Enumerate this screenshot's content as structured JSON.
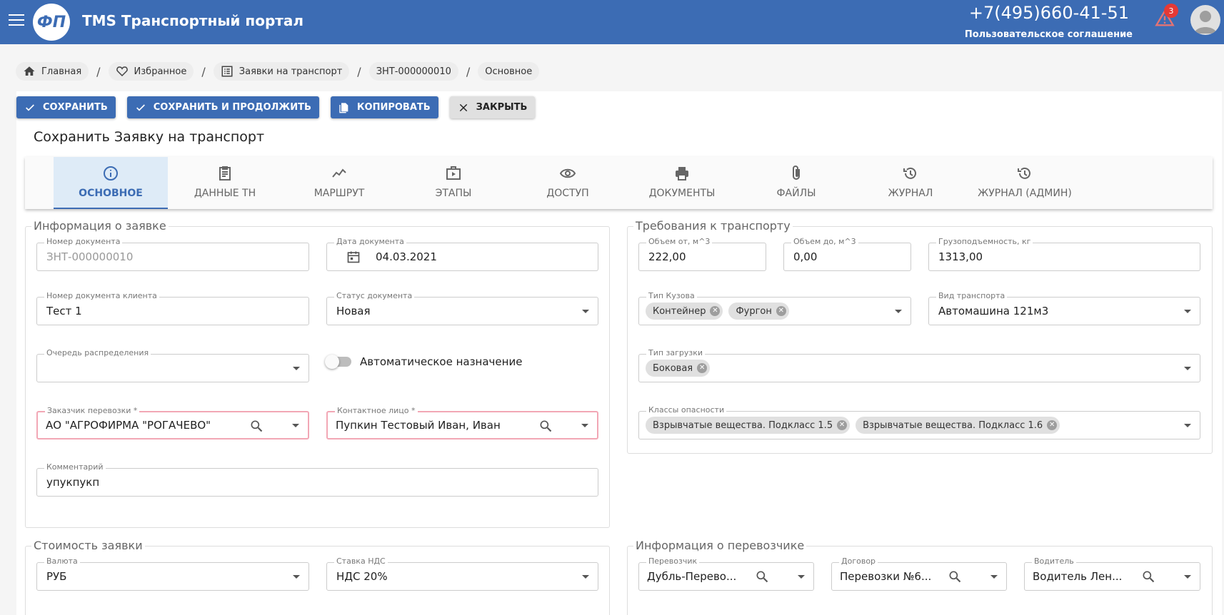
{
  "header": {
    "logo_text": "ФП",
    "app_title": "TMS Транспортный портал",
    "phone": "+7(495)660-41-51",
    "agreement": "Пользовательское соглашение",
    "notifications_count": "3"
  },
  "breadcrumbs": [
    "Главная",
    "Избранное",
    "Заявки на транспорт",
    "ЗНТ-000000010",
    "Основное"
  ],
  "toolbar": {
    "save": "СОХРАНИТЬ",
    "save_continue": "СОХРАНИТЬ И ПРОДОЛЖИТЬ",
    "copy": "КОПИРОВАТЬ",
    "close": "ЗАКРЫТЬ"
  },
  "page_title": "Сохранить Заявку на транспорт",
  "tabs": [
    "ОСНОВНОЕ",
    "ДАННЫЕ ТН",
    "МАРШРУТ",
    "ЭТАПЫ",
    "ДОСТУП",
    "ДОКУМЕНТЫ",
    "ФАЙЛЫ",
    "ЖУРНАЛ",
    "ЖУРНАЛ (АДМИН)"
  ],
  "colors": {
    "primary": "#3c6cb4",
    "error_border": "#f2a7b5",
    "badge": "#e53935"
  },
  "order_info": {
    "title": "Информация о заявке",
    "doc_number": {
      "label": "Номер документа",
      "value": "ЗНТ-000000010"
    },
    "doc_date": {
      "label": "Дата документа",
      "value": "04.03.2021"
    },
    "client_doc_number": {
      "label": "Номер документа клиента",
      "value": "Тест 1"
    },
    "doc_status": {
      "label": "Статус документа",
      "value": "Новая"
    },
    "queue": {
      "label": "Очередь распределения",
      "value": ""
    },
    "auto_assign": {
      "label": "Автоматическое назначение",
      "enabled": false
    },
    "customer": {
      "label": "Заказчик перевозки *",
      "value": "АО \"АГРОФИРМА \"РОГАЧЕВО\""
    },
    "contact": {
      "label": "Контактное лицо *",
      "value": "Пупкин Тестовый Иван, Иван"
    },
    "comment": {
      "label": "Комментарий",
      "value": "упукпукп"
    }
  },
  "transport_req": {
    "title": "Требования к транспорту",
    "volume_from": {
      "label": "Объем от, м^3",
      "value": "222,00"
    },
    "volume_to": {
      "label": "Объем до, м^3",
      "value": "0,00"
    },
    "capacity": {
      "label": "Грузоподъемность, кг",
      "value": "1313,00"
    },
    "body_type": {
      "label": "Тип Кузова",
      "chips": [
        "Контейнер",
        "Фургон"
      ]
    },
    "transport_type": {
      "label": "Вид транспорта",
      "value": "Автомашина 121м3"
    },
    "loading_type": {
      "label": "Тип загрузки",
      "chips": [
        "Боковая"
      ]
    },
    "hazard_classes": {
      "label": "Классы опасности",
      "chips": [
        "Взрывчатые вещества. Подкласс 1.5",
        "Взрывчатые вещества. Подкласс 1.6"
      ]
    }
  },
  "cost": {
    "title": "Стоимость заявки",
    "currency": {
      "label": "Валюта",
      "value": "РУБ"
    },
    "vat": {
      "label": "Ставка НДС",
      "value": "НДС 20%"
    }
  },
  "carrier": {
    "title": "Информация о перевозчике",
    "carrier": {
      "label": "Перевозчик",
      "value": "Дубль-Перево..."
    },
    "contract": {
      "label": "Договор",
      "value": "Перевозки №6..."
    },
    "driver": {
      "label": "Водитель",
      "value": "Водитель Лен..."
    }
  }
}
